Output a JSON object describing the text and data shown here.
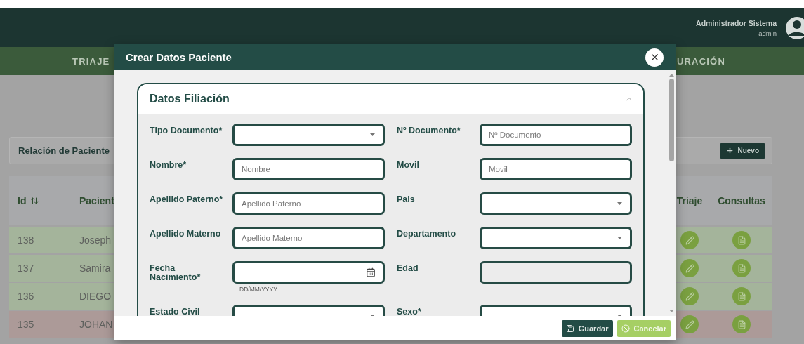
{
  "header": {
    "user_name": "Administrador Sistema",
    "user_login": "admin"
  },
  "nav": [
    {
      "label": "TRIAJE"
    },
    {
      "label": "URACIÓN"
    }
  ],
  "panel": {
    "title": "Relación de Paciente",
    "new_button": "Nuevo"
  },
  "table": {
    "columns": [
      {
        "label": "Id",
        "sortable": true
      },
      {
        "label": "Pacient",
        "sortable": false
      },
      {
        "label": "Triaje",
        "sortable": false
      },
      {
        "label": "Consultas",
        "sortable": false
      }
    ],
    "rows": [
      {
        "id": "138",
        "name": "Joseph",
        "color": "#a4b49b"
      },
      {
        "id": "137",
        "name": "Samira",
        "color": "#a4b49b"
      },
      {
        "id": "136",
        "name": "DIEGO",
        "color": "#a4b49b"
      },
      {
        "id": "135",
        "name": "JOHAN",
        "color": "#ac9a98"
      }
    ]
  },
  "modal": {
    "title": "Crear Datos Paciente",
    "section": {
      "title": "Datos Filiación",
      "expanded": true,
      "fields": [
        {
          "label": "Tipo Documento*",
          "kind": "select"
        },
        {
          "label": "Nº Documento*",
          "kind": "text",
          "placeholder": "Nº Documento"
        },
        {
          "label": "Nombre*",
          "kind": "text",
          "placeholder": "Nombre"
        },
        {
          "label": "Movil",
          "kind": "text",
          "placeholder": "Movil"
        },
        {
          "label": "Apellido Paterno*",
          "kind": "text",
          "placeholder": "Apellido Paterno"
        },
        {
          "label": "Pais",
          "kind": "select"
        },
        {
          "label": "Apellido Materno",
          "kind": "text",
          "placeholder": "Apellido Materno"
        },
        {
          "label": "Departamento",
          "kind": "select"
        },
        {
          "label": "Fecha Nacimiento*",
          "kind": "date",
          "hint": "DD/MM/YYYY"
        },
        {
          "label": "Edad",
          "kind": "readonly"
        },
        {
          "label": "Estado Civil",
          "kind": "select"
        },
        {
          "label": "Sexo*",
          "kind": "select"
        }
      ]
    },
    "buttons": [
      {
        "label": "Guardar",
        "kind": "primary"
      },
      {
        "label": "Cancelar",
        "kind": "secondary"
      }
    ]
  }
}
